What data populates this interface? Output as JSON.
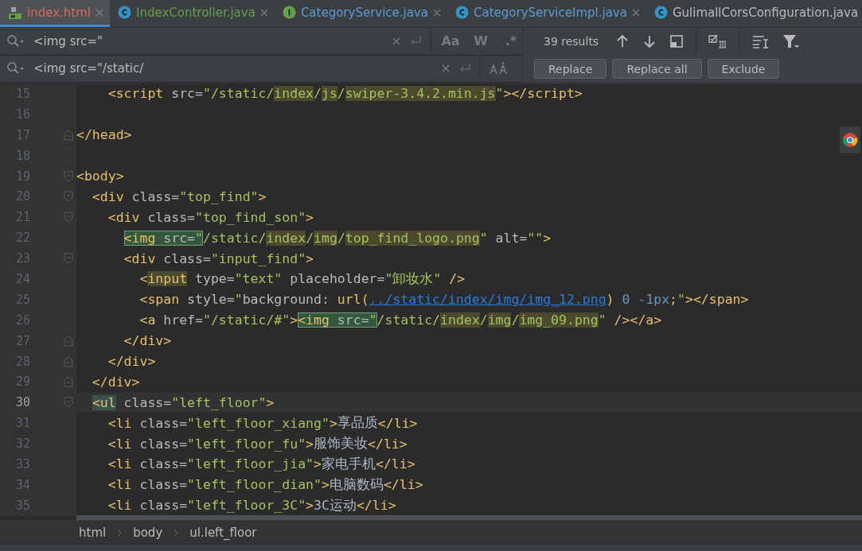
{
  "tabs": [
    {
      "label": "index.html",
      "kind": "html",
      "color": "#d66a5f",
      "selected": true
    },
    {
      "label": "IndexController.java",
      "kind": "class",
      "color": "#62a04b",
      "selected": false
    },
    {
      "label": "CategoryService.java",
      "kind": "interface",
      "color": "#5b9bd5",
      "selected": false
    },
    {
      "label": "CategoryServiceImpl.java",
      "kind": "class",
      "color": "#5b9bd5",
      "selected": false
    },
    {
      "label": "GulimallCorsConfiguration.java",
      "kind": "class",
      "color": "#bbbbbb",
      "selected": false
    }
  ],
  "search": {
    "find": {
      "value": "<img src=\"",
      "options": [
        "Aa",
        "W",
        ".*"
      ]
    },
    "replace": {
      "value": "<img src=\"/static/"
    },
    "results": "39 results",
    "buttons": [
      "Replace",
      "Replace all",
      "Exclude"
    ]
  },
  "lines": [
    {
      "number": "15",
      "current": false,
      "tokens": [
        {
          "text": "    <script",
          "kind": "tag"
        },
        {
          "text": " src=",
          "kind": "attr"
        },
        {
          "text": "\"/static/",
          "kind": "value"
        },
        {
          "text": "index",
          "kind": "value",
          "match": true
        },
        {
          "text": "/",
          "kind": "value"
        },
        {
          "text": "js",
          "kind": "value",
          "match": true
        },
        {
          "text": "/",
          "kind": "value"
        },
        {
          "text": "swiper-3.4.2.min.js",
          "kind": "value",
          "match": true
        },
        {
          "text": "\"",
          "kind": "value"
        },
        {
          "text": "></script>",
          "kind": "tag"
        }
      ]
    },
    {
      "number": "16",
      "current": false
    },
    {
      "number": "17",
      "current": false,
      "fold_end": true,
      "tokens": [
        {
          "text": "</head>",
          "kind": "tag"
        }
      ]
    },
    {
      "number": "18",
      "current": false
    },
    {
      "number": "19",
      "current": false,
      "fold_start": true,
      "tokens": [
        {
          "text": "<body>",
          "kind": "tag"
        }
      ]
    },
    {
      "number": "20",
      "current": false,
      "fold_start": true,
      "tokens": [
        {
          "text": "  <div",
          "kind": "tag"
        },
        {
          "text": " class=",
          "kind": "attr"
        },
        {
          "text": "\"top_find\"",
          "kind": "value"
        },
        {
          "text": ">",
          "kind": "tag"
        }
      ]
    },
    {
      "number": "21",
      "current": false,
      "fold_start": true,
      "tokens": [
        {
          "text": "    <div",
          "kind": "tag"
        },
        {
          "text": " class=",
          "kind": "attr"
        },
        {
          "text": "\"top_find_son\"",
          "kind": "value"
        },
        {
          "text": ">",
          "kind": "tag"
        }
      ]
    },
    {
      "number": "22",
      "current": false,
      "tokens": [
        {
          "current_match": true,
          "parts": [
            {
              "text": "      <img",
              "kind": "tag"
            },
            {
              "text": " src=",
              "kind": "attr"
            },
            {
              "text": "\"",
              "kind": "value"
            }
          ]
        },
        {
          "text": "/static/",
          "kind": "value"
        },
        {
          "text": "index",
          "kind": "value",
          "match": true
        },
        {
          "text": "/",
          "kind": "value"
        },
        {
          "text": "img",
          "kind": "value",
          "match": true
        },
        {
          "text": "/",
          "kind": "value"
        },
        {
          "text": "top_find_logo.png",
          "kind": "value",
          "match": true
        },
        {
          "text": "\"",
          "kind": "value"
        },
        {
          "text": " alt=",
          "kind": "attr"
        },
        {
          "text": "\"\"",
          "kind": "value"
        },
        {
          "text": ">",
          "kind": "tag"
        }
      ]
    },
    {
      "number": "23",
      "current": false,
      "fold_start": true,
      "tokens": [
        {
          "text": "      <div",
          "kind": "tag"
        },
        {
          "text": " class=",
          "kind": "attr"
        },
        {
          "text": "\"input_find\"",
          "kind": "value"
        },
        {
          "text": ">",
          "kind": "tag"
        }
      ]
    },
    {
      "number": "24",
      "current": false,
      "tokens": [
        {
          "text": "        <",
          "kind": "tag"
        },
        {
          "text": "input",
          "kind": "tag",
          "match": true
        },
        {
          "text": " type=",
          "kind": "attr"
        },
        {
          "text": "\"text\"",
          "kind": "value"
        },
        {
          "text": " placeholder=",
          "kind": "attr"
        },
        {
          "text": "\"卸妆水\"",
          "kind": "value"
        },
        {
          "text": " />",
          "kind": "tag"
        }
      ]
    },
    {
      "number": "25",
      "current": false,
      "tokens": [
        {
          "text": "        <span",
          "kind": "tag"
        },
        {
          "text": " style=",
          "kind": "attr"
        },
        {
          "text": "\"",
          "kind": "value"
        },
        {
          "text": "background",
          "kind": "attr"
        },
        {
          "text": ": ",
          "kind": "text"
        },
        {
          "text": "url(",
          "kind": "tag"
        },
        {
          "text": "../static/index/img/img_12.png",
          "kind": "url"
        },
        {
          "text": ")",
          "kind": "tag"
        },
        {
          "text": " 0 -1px",
          "kind": "number"
        },
        {
          "text": ";",
          "kind": "tag"
        },
        {
          "text": "\"",
          "kind": "value"
        },
        {
          "text": "></span>",
          "kind": "tag"
        }
      ]
    },
    {
      "number": "26",
      "current": false,
      "tokens": [
        {
          "text": "        <a",
          "kind": "tag"
        },
        {
          "text": " href=",
          "kind": "attr"
        },
        {
          "text": "\"/static/#\"",
          "kind": "value"
        },
        {
          "text": ">",
          "kind": "tag"
        },
        {
          "current_match": true,
          "parts": [
            {
              "text": "<img",
              "kind": "tag"
            },
            {
              "text": " src=",
              "kind": "attr"
            },
            {
              "text": "\"",
              "kind": "value"
            }
          ]
        },
        {
          "text": "/static/",
          "kind": "value"
        },
        {
          "text": "index",
          "kind": "value",
          "match": true
        },
        {
          "text": "/",
          "kind": "value"
        },
        {
          "text": "img",
          "kind": "value",
          "match": true
        },
        {
          "text": "/",
          "kind": "value"
        },
        {
          "text": "img_09.png",
          "kind": "value",
          "match": true
        },
        {
          "text": "\"",
          "kind": "value"
        },
        {
          "text": " /></a>",
          "kind": "tag"
        }
      ]
    },
    {
      "number": "27",
      "current": false,
      "fold_end": true,
      "tokens": [
        {
          "text": "      </div>",
          "kind": "tag"
        }
      ]
    },
    {
      "number": "28",
      "current": false,
      "fold_end": true,
      "tokens": [
        {
          "text": "    </div>",
          "kind": "tag"
        }
      ]
    },
    {
      "number": "29",
      "current": false,
      "fold_end": true,
      "tokens": [
        {
          "text": "  </div>",
          "kind": "tag"
        }
      ]
    },
    {
      "number": "30",
      "current": true,
      "fold_start": true,
      "tokens": [
        {
          "text": "  <ul",
          "kind": "tag",
          "paired": true
        },
        {
          "text": " class=",
          "kind": "attr"
        },
        {
          "text": "\"left_floor\"",
          "kind": "value"
        },
        {
          "text": ">",
          "kind": "tag"
        }
      ]
    },
    {
      "number": "31",
      "current": false,
      "tokens": [
        {
          "text": "    <li",
          "kind": "tag"
        },
        {
          "text": " class=",
          "kind": "attr"
        },
        {
          "text": "\"left_floor_xiang\"",
          "kind": "value"
        },
        {
          "text": ">",
          "kind": "tag"
        },
        {
          "text": "享品质",
          "kind": "text"
        },
        {
          "text": "</li>",
          "kind": "tag"
        }
      ]
    },
    {
      "number": "32",
      "current": false,
      "tokens": [
        {
          "text": "    <li",
          "kind": "tag"
        },
        {
          "text": " class=",
          "kind": "attr"
        },
        {
          "text": "\"left_floor_fu\"",
          "kind": "value"
        },
        {
          "text": ">",
          "kind": "tag"
        },
        {
          "text": "服饰美妆",
          "kind": "text"
        },
        {
          "text": "</li>",
          "kind": "tag"
        }
      ]
    },
    {
      "number": "33",
      "current": false,
      "tokens": [
        {
          "text": "    <li",
          "kind": "tag"
        },
        {
          "text": " class=",
          "kind": "attr"
        },
        {
          "text": "\"left_floor_jia\"",
          "kind": "value"
        },
        {
          "text": ">",
          "kind": "tag"
        },
        {
          "text": "家电手机",
          "kind": "text"
        },
        {
          "text": "</li>",
          "kind": "tag"
        }
      ]
    },
    {
      "number": "34",
      "current": false,
      "tokens": [
        {
          "text": "    <li",
          "kind": "tag"
        },
        {
          "text": " class=",
          "kind": "attr"
        },
        {
          "text": "\"left_floor_dian\"",
          "kind": "value"
        },
        {
          "text": ">",
          "kind": "tag"
        },
        {
          "text": "电脑数码",
          "kind": "text"
        },
        {
          "text": "</li>",
          "kind": "tag"
        }
      ]
    },
    {
      "number": "35",
      "current": false,
      "tokens": [
        {
          "text": "    <li",
          "kind": "tag"
        },
        {
          "text": " class=",
          "kind": "attr"
        },
        {
          "text": "\"left_floor_3C\"",
          "kind": "value"
        },
        {
          "text": ">",
          "kind": "tag"
        },
        {
          "text": "3C运动",
          "kind": "text"
        },
        {
          "text": "</li>",
          "kind": "tag"
        }
      ]
    }
  ],
  "breadcrumbs": [
    "html",
    "body",
    "ul.left_floor"
  ]
}
